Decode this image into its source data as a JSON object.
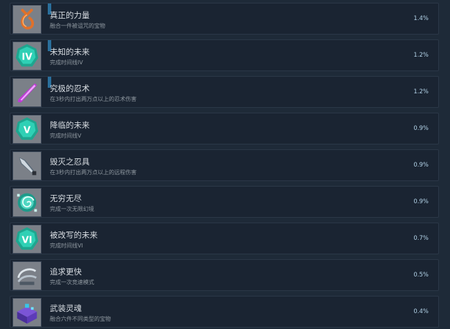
{
  "achievements": [
    {
      "title": "真正的力量",
      "desc": "融合一件被诅咒的宝物",
      "pct": "1.4%",
      "icon": "orange-rune-icon"
    },
    {
      "title": "未知的未来",
      "desc": "完成时间线IV",
      "pct": "1.2%",
      "icon": "timeline-iv-orb-icon",
      "icon_text": "IV"
    },
    {
      "title": "究极的忍术",
      "desc": "在3秒内打出两万点以上的忍术伤害",
      "pct": "1.2%",
      "icon": "purple-blade-icon"
    },
    {
      "title": "降临的未来",
      "desc": "完成时间线V",
      "pct": "0.9%",
      "icon": "timeline-v-orb-icon",
      "icon_text": "V"
    },
    {
      "title": "毁灭之忍具",
      "desc": "在3秒内打出两万点以上的远程伤害",
      "pct": "0.9%",
      "icon": "kunai-icon"
    },
    {
      "title": "无穷无尽",
      "desc": "完成一次无限幻境",
      "pct": "0.9%",
      "icon": "spiral-orb-icon"
    },
    {
      "title": "被改写的未来",
      "desc": "完成时间线VI",
      "pct": "0.7%",
      "icon": "timeline-vi-orb-icon",
      "icon_text": "VI"
    },
    {
      "title": "追求更快",
      "desc": "完成一次竞速模式",
      "pct": "0.5%",
      "icon": "speed-wing-icon"
    },
    {
      "title": "武装灵魂",
      "desc": "融合六件不同类型的宝物",
      "pct": "0.4%",
      "icon": "purple-chest-icon"
    }
  ]
}
